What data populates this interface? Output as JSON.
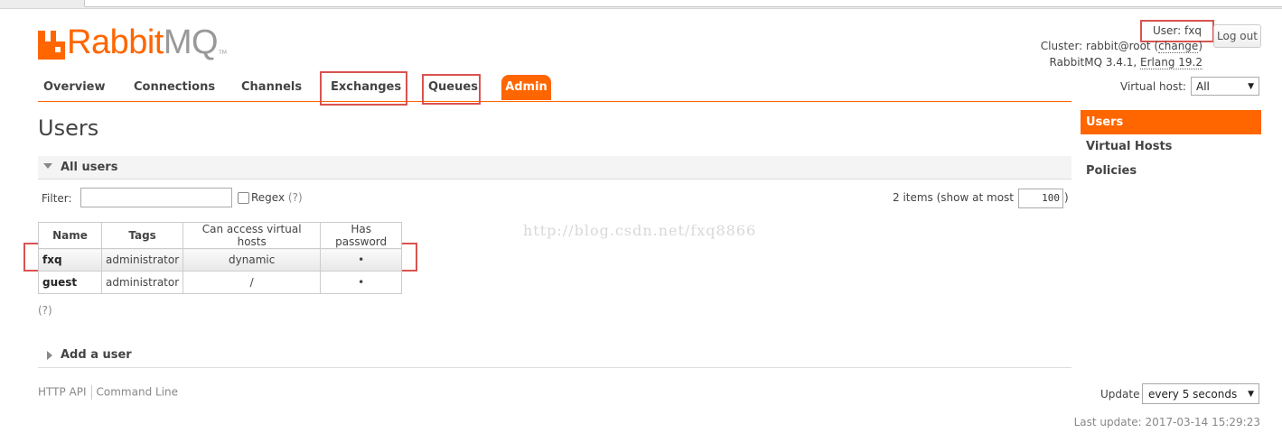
{
  "header": {
    "logo_text": "Rabbit",
    "logo_mq": "MQ",
    "logo_tm": "TM",
    "user_label": "User: fxq",
    "logout_label": "Log out",
    "cluster_prefix": "Cluster: rabbit@root (",
    "cluster_change": "change",
    "cluster_suffix": ")",
    "version_prefix": "RabbitMQ 3.4.1, ",
    "version_erlang": "Erlang 19.2",
    "vhost_label": "Virtual host:",
    "vhost_value": "All"
  },
  "nav": {
    "overview": "Overview",
    "connections": "Connections",
    "channels": "Channels",
    "exchanges": "Exchanges",
    "queues": "Queues",
    "admin": "Admin"
  },
  "main": {
    "title": "Users",
    "all_users": "All users",
    "filter_label": "Filter:",
    "regex_label": "Regex",
    "regex_help": "(?)",
    "items_label": "2 items (show at most",
    "items_value": "100",
    "items_close": ")",
    "help_link": "(?)",
    "add_user": "Add a user"
  },
  "table": {
    "headers": {
      "name": "Name",
      "tags": "Tags",
      "vhosts": "Can access virtual hosts",
      "password": "Has password"
    },
    "rows": [
      {
        "name": "fxq",
        "tags": "administrator",
        "vhosts": "dynamic",
        "password": "•"
      },
      {
        "name": "guest",
        "tags": "administrator",
        "vhosts": "/",
        "password": "•"
      }
    ]
  },
  "sidebar": {
    "items": [
      {
        "label": "Users",
        "active": true
      },
      {
        "label": "Virtual Hosts"
      },
      {
        "label": "Policies"
      }
    ]
  },
  "footer": {
    "http_api": "HTTP API",
    "command_line": "Command Line",
    "update_label": "Update",
    "update_value": "every 5 seconds",
    "last_update": "Last update: 2017-03-14 15:29:23"
  },
  "watermark": "http://blog.csdn.net/fxq8866",
  "colors": {
    "accent": "#ff6600",
    "highlight": "#d9534f"
  },
  "icons": {
    "logo": "rabbit-logo-icon",
    "dropdown": "chevron-down-icon",
    "collapse": "triangle-down-icon",
    "expand": "triangle-right-icon"
  }
}
